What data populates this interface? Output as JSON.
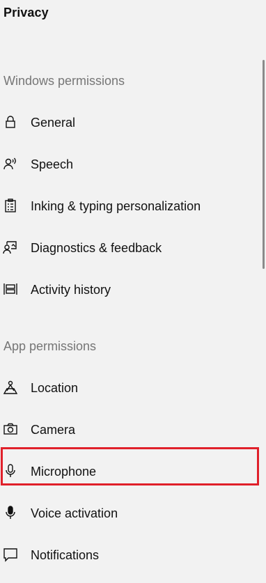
{
  "title": "Privacy",
  "sections": [
    {
      "heading": "Windows permissions",
      "items": [
        {
          "label": "General",
          "icon": "lock-icon"
        },
        {
          "label": "Speech",
          "icon": "speech-icon"
        },
        {
          "label": "Inking & typing personalization",
          "icon": "clipboard-icon"
        },
        {
          "label": "Diagnostics & feedback",
          "icon": "feedback-icon"
        },
        {
          "label": "Activity history",
          "icon": "timeline-icon"
        }
      ]
    },
    {
      "heading": "App permissions",
      "items": [
        {
          "label": "Location",
          "icon": "location-icon"
        },
        {
          "label": "Camera",
          "icon": "camera-icon"
        },
        {
          "label": "Microphone",
          "icon": "microphone-icon",
          "highlighted": true
        },
        {
          "label": "Voice activation",
          "icon": "voice-activation-icon"
        },
        {
          "label": "Notifications",
          "icon": "notifications-icon"
        }
      ]
    }
  ],
  "colors": {
    "background": "#f2f2f2",
    "highlight_border": "#e0202a",
    "section_heading": "#767676"
  }
}
